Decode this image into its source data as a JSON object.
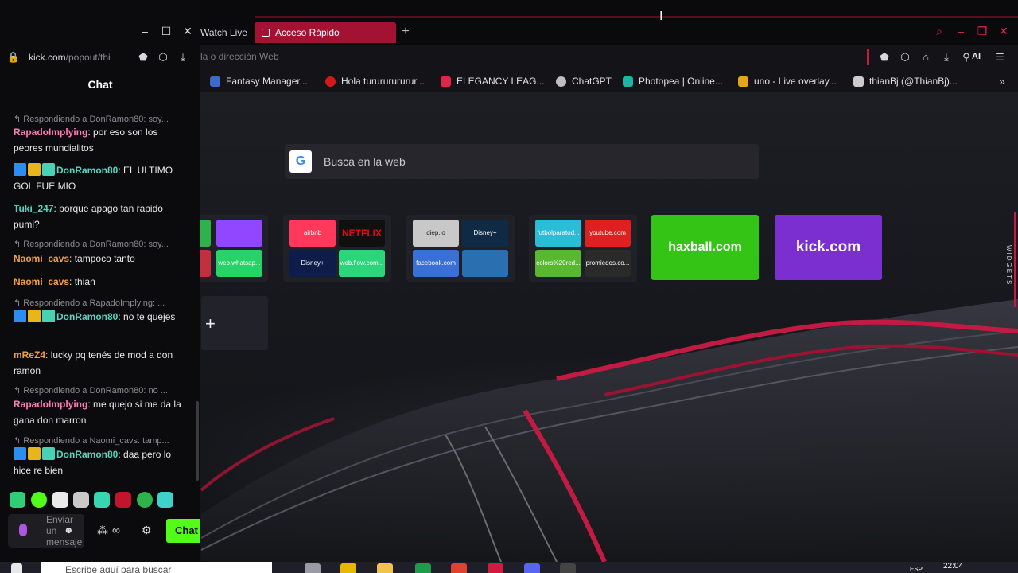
{
  "browser": {
    "tabs": [
      {
        "label": "Watch Live"
      },
      {
        "label": "Acceso Rápido",
        "active": true
      }
    ],
    "address_placeholder": "la o dirección Web",
    "ai_label": "AI",
    "bookmarks": [
      {
        "label": "Fantasy Manager...",
        "color": "#3b6cc9"
      },
      {
        "label": "Hola turururururur...",
        "color": "#d11a1a"
      },
      {
        "label": "ELEGANCY LEAG...",
        "color": "#e0254a"
      },
      {
        "label": "ChatGPT",
        "color": "#bfbfbf"
      },
      {
        "label": "Photopea | Online...",
        "color": "#1fb4a4"
      },
      {
        "label": "uno - Live overlay...",
        "color": "#e6a517"
      },
      {
        "label": "thianBj (@ThianBj)...",
        "color": "#cccccc"
      }
    ],
    "search_placeholder": "Busca en la web",
    "widgets_label": "WIDGETS",
    "speed_dial": {
      "groups": [
        {
          "items": [
            {
              "label": "",
              "color": "#2fb24c"
            },
            {
              "label": "",
              "color": "#9146ff"
            },
            {
              "label": "",
              "color": "#c0303d"
            },
            {
              "label": "web.whatsap...",
              "color": "#25d366"
            }
          ]
        },
        {
          "items": [
            {
              "label": "airbnb",
              "color": "#ff385c"
            },
            {
              "label": "NETFLIX",
              "color": "#101010"
            },
            {
              "label": "Disney+",
              "color": "#0e1c4a"
            },
            {
              "label": "web.flow.com...",
              "color": "#2bd67b"
            }
          ]
        },
        {
          "items": [
            {
              "label": "diep.io",
              "color": "#c8c8c8"
            },
            {
              "label": "Disney+",
              "color": "#0f2a45"
            },
            {
              "label": "facebook.com",
              "color": "#3b6fd8"
            },
            {
              "label": "",
              "color": "#2a6fb0"
            }
          ]
        },
        {
          "items": [
            {
              "label": "futbolparatod...",
              "color": "#2bbcd6"
            },
            {
              "label": "youtube.com",
              "color": "#e02020"
            },
            {
              "label": "colors%20red...",
              "color": "#5ab830"
            },
            {
              "label": "promiedos.co...",
              "color": "#2a2a2a"
            }
          ]
        }
      ],
      "big": [
        {
          "label": "haxball.com",
          "color": "#33c416"
        },
        {
          "label": "kick.com",
          "color": "#7b2fd0"
        }
      ],
      "add_label": "+"
    }
  },
  "chat": {
    "url_host": "kick.com",
    "url_path": "/popout/thi",
    "title": "Chat",
    "messages": [
      {
        "reply": "Respondiendo a DonRamon80: soy...",
        "user": "RapadoImplying",
        "color": "pink",
        "badges": false,
        "text": "por eso son los peores mundialitos"
      },
      {
        "reply": "",
        "user": "DonRamon80",
        "color": "teal",
        "badges": true,
        "text": "EL ULTIMO GOL FUE MIO"
      },
      {
        "reply": "",
        "user": "Tuki_247",
        "color": "teal",
        "badges": false,
        "text": "porque apago tan rapido pumi?"
      },
      {
        "reply": "Respondiendo a DonRamon80: soy...",
        "user": "Naomi_cavs",
        "color": "orange",
        "badges": false,
        "text": "tampoco tanto"
      },
      {
        "reply": "",
        "user": "Naomi_cavs",
        "color": "orange",
        "badges": false,
        "text": "thian"
      },
      {
        "reply": "Respondiendo a RapadoImplying: ...",
        "user": "DonRamon80",
        "color": "teal",
        "badges": true,
        "text": "no te quejes"
      },
      {
        "reply": "",
        "user": "mReZ4",
        "color": "orange",
        "badges": false,
        "text": "lucky pq tenés de mod a don ramon"
      },
      {
        "reply": "Respondiendo a DonRamon80: no ...",
        "user": "RapadoImplying",
        "color": "pink",
        "badges": false,
        "text": "me quejo si me da la gana don marron"
      },
      {
        "reply": "Respondiendo a Naomi_cavs: tamp...",
        "user": "DonRamon80",
        "color": "teal",
        "badges": true,
        "text": "daa pero lo hice re bien"
      }
    ],
    "input_placeholder": "Enviar un mensaje",
    "send_label": "Chat"
  },
  "taskbar": {
    "search_placeholder": "Escribe aquí para buscar",
    "lang": "ESP",
    "clock": "22:04"
  },
  "colors": {
    "accent": "#c81a3f",
    "kick_green": "#53fc18"
  }
}
